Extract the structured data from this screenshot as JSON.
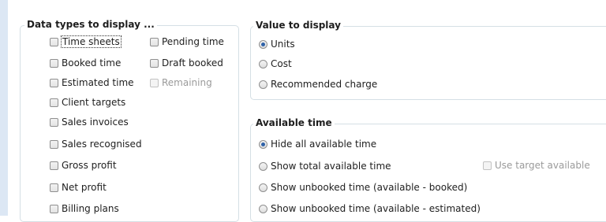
{
  "data_types": {
    "title": "Data types to display ...",
    "time_sheets": "Time sheets",
    "pending_time": "Pending time",
    "booked_time": "Booked time",
    "draft_booked": "Draft booked",
    "estimated_time": "Estimated time",
    "remaining": "Remaining",
    "client_targets": "Client targets",
    "sales_invoices": "Sales invoices",
    "sales_recognised": "Sales recognised",
    "gross_profit": "Gross profit",
    "net_profit": "Net profit",
    "billing_plans": "Billing plans"
  },
  "value_to_display": {
    "title": "Value to display",
    "units": "Units",
    "cost": "Cost",
    "recommended_charge": "Recommended charge",
    "selected": "Units"
  },
  "available_time": {
    "title": "Available time",
    "hide_all": "Hide all available time",
    "show_total": "Show total available time",
    "use_target_available": "Use target available",
    "show_unbooked_booked": "Show unbooked time (available - booked)",
    "show_unbooked_estimated": "Show unbooked time (available - estimated)",
    "selected": "Hide all available time"
  }
}
